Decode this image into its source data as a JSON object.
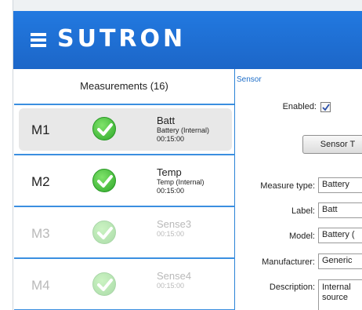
{
  "header": {
    "brand": "SUTRON"
  },
  "measurements": {
    "title": "Measurements (16)",
    "items": [
      {
        "id": "M1",
        "name": "Batt",
        "description": "Battery (Internal)",
        "interval": "00:15:00",
        "enabled": true,
        "selected": true
      },
      {
        "id": "M2",
        "name": "Temp",
        "description": "Temp (Internal)",
        "interval": "00:15:00",
        "enabled": true,
        "selected": false
      },
      {
        "id": "M3",
        "name": "Sense3",
        "description": "",
        "interval": "00:15:00",
        "enabled": false,
        "selected": false
      },
      {
        "id": "M4",
        "name": "Sense4",
        "description": "",
        "interval": "00:15:00",
        "enabled": false,
        "selected": false
      }
    ]
  },
  "sensor": {
    "group_title": "Sensor",
    "enabled_label": "Enabled:",
    "enabled": true,
    "sensor_button": "Sensor T",
    "measure_type_label": "Measure type:",
    "measure_type_value": "Battery",
    "label_label": "Label:",
    "label_value": "Batt",
    "model_label": "Model:",
    "model_value": "Battery (",
    "manufacturer_label": "Manufacturer:",
    "manufacturer_value": "Generic",
    "description_label": "Description:",
    "description_value_line1": "Internal",
    "description_value_line2": "source"
  },
  "colors": {
    "header": "#1f6fd6",
    "accent": "#3b8fe0",
    "check": "#2fa82a"
  }
}
